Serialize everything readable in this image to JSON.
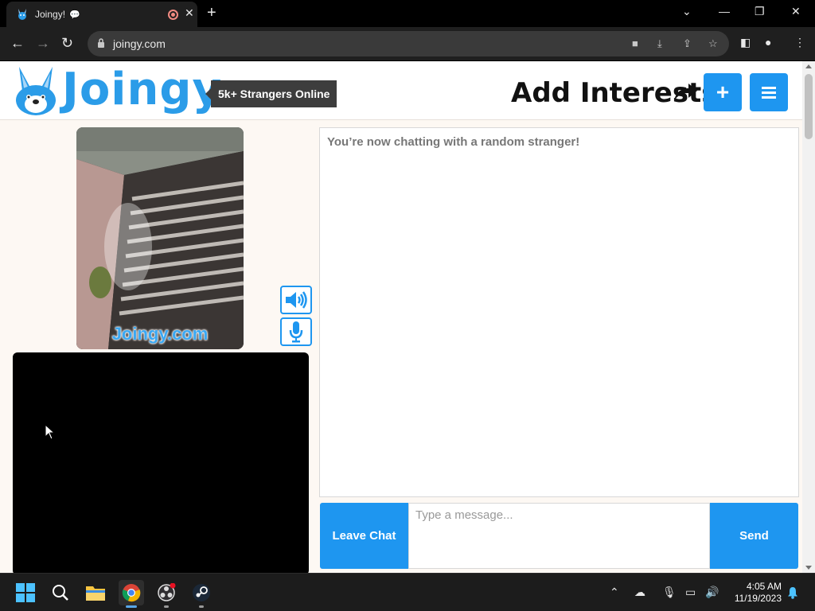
{
  "browser": {
    "tab_title": "Joingy!",
    "tab_bubble_icon": "speech-bubble-icon",
    "url": "joingy.com",
    "new_tab_label": "+"
  },
  "header": {
    "logo_text": "Joingy",
    "online_badge": "5k+ Strangers Online",
    "add_interests": "Add Interests",
    "add_button_label": "+",
    "menu_icon": "hamburger-menu-icon"
  },
  "video": {
    "watermark": "Joingy.com"
  },
  "chat": {
    "status_message": "You’re now chatting with a random stranger!",
    "input_placeholder": "Type a message...",
    "leave_label": "Leave Chat",
    "send_label": "Send"
  },
  "taskbar": {
    "time": "4:05 AM",
    "date": "11/19/2023"
  },
  "colors": {
    "brand_blue": "#1e96f0",
    "logo_blue": "#2b9ce8",
    "page_bg": "#fdf8f3"
  }
}
